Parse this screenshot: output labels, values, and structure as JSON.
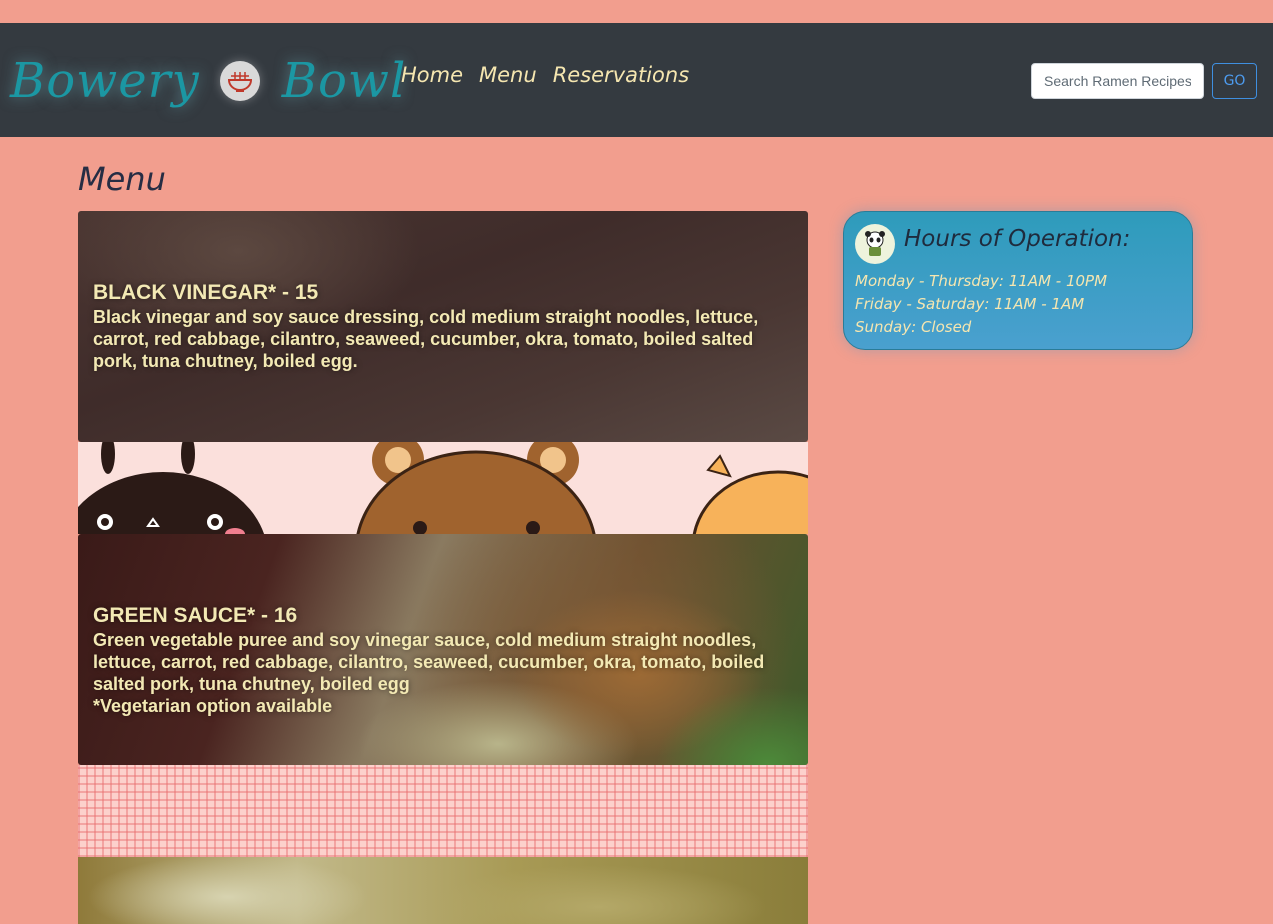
{
  "brand": {
    "name_left": "Bowery",
    "name_right": "Bowl"
  },
  "nav": {
    "items": [
      {
        "label": "Home"
      },
      {
        "label": "Menu"
      },
      {
        "label": "Reservations"
      }
    ]
  },
  "search": {
    "placeholder": "Search Ramen Recipes",
    "button_label": "GO"
  },
  "page": {
    "title": "Menu"
  },
  "menu": {
    "items": [
      {
        "name": "BLACK VINEGAR* - 15",
        "description": "Black vinegar and soy sauce dressing, cold medium straight noodles, lettuce, carrot, red cabbage, cilantro, seaweed, cucumber, okra, tomato, boiled salted pork, tuna chutney, boiled egg."
      },
      {
        "name": "GREEN SAUCE* - 16",
        "description": "Green vegetable puree and soy vinegar sauce, cold medium straight noodles, lettuce, carrot, red cabbage, cilantro, seaweed, cucumber, okra, tomato, boiled salted pork, tuna chutney, boiled egg",
        "note": "*Vegetarian option available"
      }
    ]
  },
  "hours": {
    "title": "Hours of Operation:",
    "lines": [
      "Monday - Thursday: 11AM - 10PM",
      "Friday - Saturday: 11AM - 1AM",
      "Sunday: Closed"
    ]
  }
}
